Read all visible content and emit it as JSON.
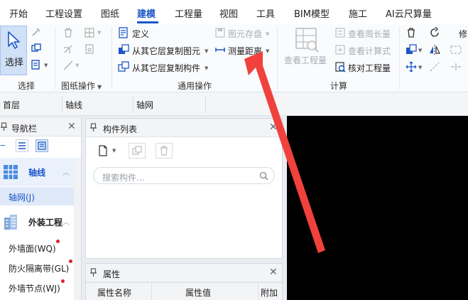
{
  "menu": {
    "items": [
      "开始",
      "工程设置",
      "图纸",
      "建模",
      "工程量",
      "视图",
      "工具",
      "BIM模型",
      "施工",
      "AI云尺算量"
    ],
    "active": "建模"
  },
  "ribbon": {
    "select": {
      "label": "选择",
      "group": "选择"
    },
    "drawing_ops": {
      "group": "图纸操作"
    },
    "general_ops": {
      "group": "通用操作",
      "define": "定义",
      "copy_from_layer_element": "从其它层复制图元",
      "copy_from_layer_component": "从其它层复制构件",
      "save_element": "图元存盘",
      "measure_distance": "测量距离"
    },
    "calc": {
      "group": "计算",
      "view_quantity": "查看工程量",
      "view_perimeter": "查看周长量",
      "view_formula": "查看计算式",
      "check_quantity": "核对工程量"
    },
    "modify": {
      "label": "修"
    }
  },
  "dropdowns": {
    "floor": "首层",
    "axis1": "轴线",
    "axis2": "轴网"
  },
  "nav": {
    "title": "导航栏",
    "categories": [
      {
        "label": "轴线",
        "children": [
          "轴网(J)"
        ]
      },
      {
        "label": "外装工程",
        "children": [
          "外墙面(WQ)",
          "防火隔离带(GL)",
          "外墙节点(WJ)"
        ]
      }
    ]
  },
  "component_list": {
    "title": "构件列表",
    "search_placeholder": "搜索构件..."
  },
  "properties": {
    "title": "属性",
    "columns": [
      "属性名称",
      "属性值",
      "附加"
    ]
  },
  "icons": {
    "pin": "pin-icon",
    "close": "close-icon",
    "search": "search-icon",
    "arrow_annotation": "red-arrow-annotation"
  },
  "colors": {
    "accent": "#1a56c8",
    "arrow": "#f0413c",
    "viewport": "#000000",
    "required_dot": "#e0212b"
  }
}
